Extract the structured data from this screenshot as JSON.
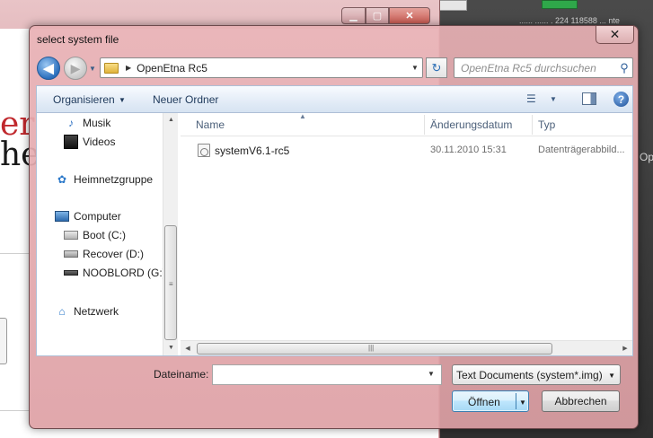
{
  "background": {
    "desktop_label": "...... ...... . 224 118588 ... nte",
    "desktop_side_text": "Op",
    "logo_red": "er",
    "logo_dark": "he",
    "window_minimize_glyph": "▁",
    "window_maximize_glyph": "▢",
    "window_close_glyph": "✕"
  },
  "dialog": {
    "title": "select system file",
    "close_glyph": "✕",
    "nav": {
      "back_glyph": "◀",
      "forward_glyph": "▶",
      "history_glyph": "▼"
    },
    "address": {
      "path": "OpenEtna Rc5",
      "separator_glyph": "▶",
      "drop_glyph": "▼"
    },
    "refresh_glyph": "↻",
    "search": {
      "placeholder": "OpenEtna Rc5 durchsuchen",
      "icon_glyph": "⚲"
    },
    "toolbar": {
      "organize_label": "Organisieren",
      "organize_arrow": "▼",
      "new_folder_label": "Neuer Ordner",
      "view_glyph": "☰",
      "view_arrow": "▼",
      "help_glyph": "?"
    },
    "nav_pane": {
      "items": [
        {
          "label": "Musik",
          "icon": "music-icon",
          "glyph": "♪"
        },
        {
          "label": "Videos",
          "icon": "video-icon",
          "glyph": ""
        },
        {
          "label": "Heimnetzgruppe",
          "icon": "homegroup-icon",
          "glyph": "✿"
        },
        {
          "label": "Computer",
          "icon": "computer-icon",
          "glyph": ""
        },
        {
          "label": "Boot (C:)",
          "icon": "drive-c-icon",
          "glyph": ""
        },
        {
          "label": "Recover (D:)",
          "icon": "drive-icon",
          "glyph": ""
        },
        {
          "label": "NOOBLORD (G:)",
          "icon": "usb-drive-icon",
          "glyph": ""
        },
        {
          "label": "Netzwerk",
          "icon": "network-icon",
          "glyph": "⌂"
        }
      ],
      "scroll_up_glyph": "▲",
      "scroll_down_glyph": "▼",
      "scroll_grip_glyph": "≡"
    },
    "file_list": {
      "columns": {
        "name": "Name",
        "date": "Änderungsdatum",
        "type": "Typ"
      },
      "sort_glyph": "▲",
      "rows": [
        {
          "name": "systemV6.1-rc5",
          "date": "30.11.2010 15:31",
          "type": "Datenträgerabbild..."
        }
      ],
      "scroll_left_glyph": "◀",
      "scroll_right_glyph": "▶",
      "scroll_grip_glyph": "|||"
    },
    "filename": {
      "label": "Dateiname:",
      "value": "",
      "drop_glyph": "▼"
    },
    "filter": {
      "selected": "Text Documents (system*.img)",
      "drop_glyph": "▼"
    },
    "buttons": {
      "open_label": "Öffnen",
      "open_arrow": "▼",
      "cancel_label": "Abbrechen"
    }
  }
}
